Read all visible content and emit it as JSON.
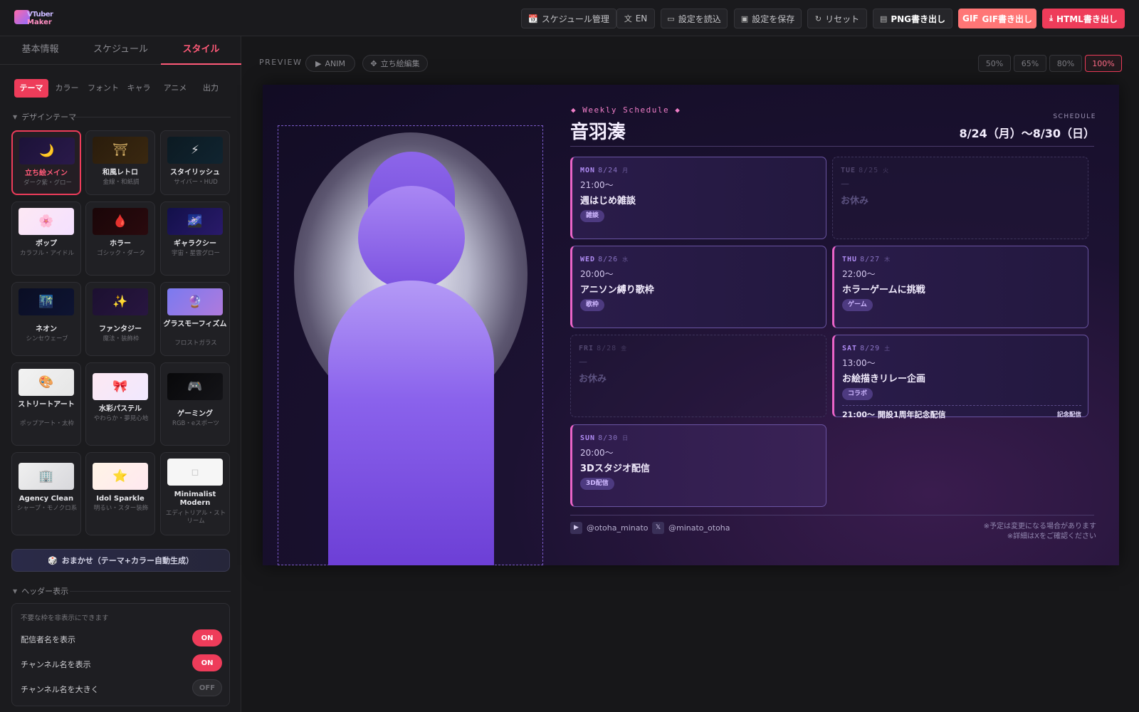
{
  "app": {
    "logo_line1": "VTuber",
    "logo_line2": "Maker"
  },
  "toolbar": {
    "schedule_mgmt": "スケジュール管理",
    "schedule_mgmt_icon": "📆",
    "lang": "EN",
    "load": "設定を読込",
    "save": "設定を保存",
    "reset": "リセット",
    "png": "PNG書き出し",
    "gif_prefix": "GIF",
    "gif": "GIF書き出し",
    "html": "HTML書き出し"
  },
  "sidebar": {
    "main_tabs": [
      "基本情報",
      "スケジュール",
      "スタイル"
    ],
    "active_main_tab": "スタイル",
    "sub_tabs": [
      "テーマ",
      "カラー",
      "フォント",
      "キャラ",
      "アニメ",
      "出力"
    ],
    "active_sub_tab": "テーマ",
    "design_theme_heading": "デザインテーマ",
    "themes": [
      {
        "name": "立ち絵メイン",
        "sub": "ダーク紫・グロー",
        "icon": "🌙",
        "active": true
      },
      {
        "name": "和風レトロ",
        "sub": "金線・和紙調",
        "icon": "⛩"
      },
      {
        "name": "スタイリッシュ",
        "sub": "サイバー・HUD",
        "icon": "⚡"
      },
      {
        "name": "ポップ",
        "sub": "カラフル・アイドル",
        "icon": "🌸"
      },
      {
        "name": "ホラー",
        "sub": "ゴシック・ダーク",
        "icon": "🩸"
      },
      {
        "name": "ギャラクシー",
        "sub": "宇宙・星雲グロー",
        "icon": "🌌"
      },
      {
        "name": "ネオン",
        "sub": "シンセウェーブ",
        "icon": "🌃"
      },
      {
        "name": "ファンタジー",
        "sub": "魔法・装飾枠",
        "icon": "✨"
      },
      {
        "name": "グラスモーフィズム",
        "sub": "フロストガラス",
        "icon": "🔮"
      },
      {
        "name": "ストリートアート",
        "sub": "ポップアート・太枠",
        "icon": "🎨"
      },
      {
        "name": "水彩パステル",
        "sub": "やわらか・夢見心地",
        "icon": "🎀"
      },
      {
        "name": "ゲーミング",
        "sub": "RGB・eスポーツ",
        "icon": "🎮"
      },
      {
        "name": "Agency Clean",
        "sub": "シャープ・モノクロ系",
        "icon": "🏢"
      },
      {
        "name": "Idol Sparkle",
        "sub": "明るい・スター装飾",
        "icon": "⭐"
      },
      {
        "name": "Minimalist Modern",
        "sub": "エディトリアル・ストリーム",
        "icon": "▫"
      }
    ],
    "omakase_icon": "🎲",
    "omakase": "おまかせ（テーマ+カラー自動生成）",
    "header_heading": "ヘッダー表示",
    "header_note": "不要な枠を非表示にできます",
    "header_options": [
      {
        "label": "配信者名を表示",
        "state": "ON"
      },
      {
        "label": "チャンネル名を表示",
        "state": "ON"
      },
      {
        "label": "チャンネル名を大きく",
        "state": "OFF"
      }
    ]
  },
  "preview": {
    "label": "PREVIEW",
    "anim": "ANIM",
    "edit": "立ち絵編集",
    "zooms": [
      "50%",
      "65%",
      "80%",
      "100%"
    ],
    "active_zoom": "100%"
  },
  "schedule": {
    "weekly_title": "Weekly Schedule",
    "streamer": "音羽湊",
    "label": "SCHEDULE",
    "range": "8/24（月）〜8/30（日）",
    "days": [
      {
        "en": "MON",
        "date": "8/24",
        "jp": "月",
        "time": "21:00〜",
        "title": "週はじめ雑談",
        "tag": "雑談",
        "off": false
      },
      {
        "en": "TUE",
        "date": "8/25",
        "jp": "火",
        "time": "—",
        "title": "お休み",
        "tag": "",
        "off": true
      },
      {
        "en": "WED",
        "date": "8/26",
        "jp": "水",
        "time": "20:00〜",
        "title": "アニソン縛り歌枠",
        "tag": "歌枠",
        "off": false
      },
      {
        "en": "THU",
        "date": "8/27",
        "jp": "木",
        "time": "22:00〜",
        "title": "ホラーゲームに挑戦",
        "tag": "ゲーム",
        "off": false
      },
      {
        "en": "FRI",
        "date": "8/28",
        "jp": "金",
        "time": "—",
        "title": "お休み",
        "tag": "",
        "off": true
      },
      {
        "en": "SAT",
        "date": "8/29",
        "jp": "土",
        "time": "13:00〜",
        "title": "お絵描きリレー企画",
        "tag": "コラボ",
        "off": false,
        "extra_time": "21:00〜",
        "extra_title": "開設1周年記念配信",
        "extra_badge": "記念配信"
      },
      {
        "en": "SUN",
        "date": "8/30",
        "jp": "日",
        "time": "20:00〜",
        "title": "3Dスタジオ配信",
        "tag": "3D配信",
        "off": false
      }
    ],
    "socials": [
      {
        "icon": "youtube-icon",
        "glyph": "▶",
        "handle": "@otoha_minato"
      },
      {
        "icon": "x-icon",
        "glyph": "𝕏",
        "handle": "@minato_otoha"
      }
    ],
    "note1": "※予定は変更になる場合があります",
    "note2": "※詳細はXをご確認ください"
  },
  "colors": {
    "accent": "#ee3c5a",
    "accent_pink": "#ea64c8",
    "purple": "#7a50e0",
    "bg": "#161618"
  }
}
